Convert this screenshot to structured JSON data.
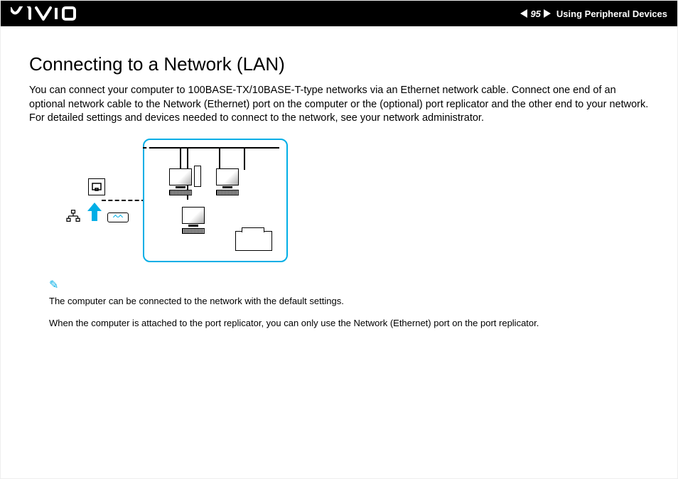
{
  "header": {
    "page_number": "95",
    "section": "Using Peripheral Devices"
  },
  "title": "Connecting to a Network (LAN)",
  "body": "You can connect your computer to 100BASE-TX/10BASE-T-type networks via an Ethernet network cable. Connect one end of an optional network cable to the Network (Ethernet) port on the computer or the (optional) port replicator and the other end to your network. For detailed settings and devices needed to connect to the network, see your network administrator.",
  "notes": {
    "n1": "The computer can be connected to the network with the default settings.",
    "n2": "When the computer is attached to the port replicator, you can only use the Network (Ethernet) port on the port replicator."
  }
}
